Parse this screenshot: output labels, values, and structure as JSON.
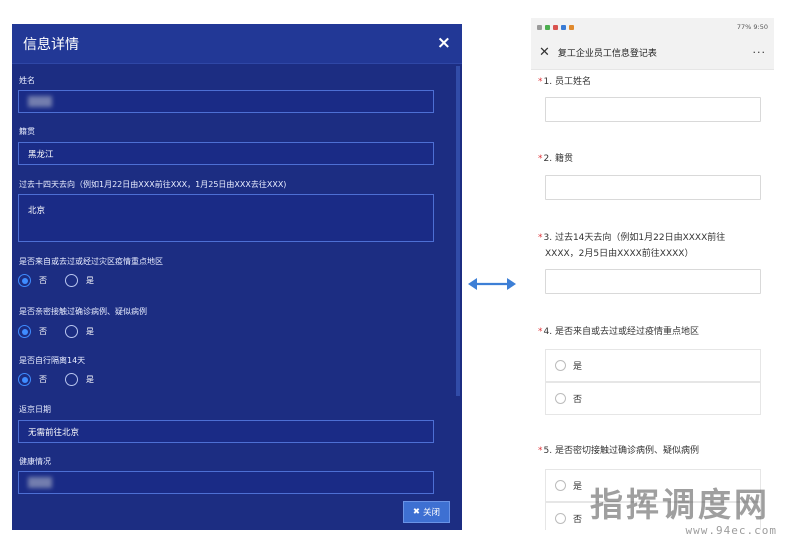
{
  "dialog": {
    "title": "信息详情",
    "close_icon": "×",
    "fields": {
      "name_label": "姓名",
      "native_label": "籍贯",
      "native_value": "黑龙江",
      "route_label": "过去十四天去向（例如1月22日由XXX前往XXX，1月25日由XXX去往XXX)",
      "route_value": "北京",
      "epidemic_label": "是否来自或去过或经过灾区疫情重点地区",
      "contact_label": "是否亲密接触过确诊病例、疑似病例",
      "isolated_label": "是否自行隔离14天",
      "return_label": "返京日期",
      "return_value": "无需前往北京",
      "health_label": "健康情况"
    },
    "radio_no": "否",
    "radio_yes": "是",
    "close_button_icon": "✖",
    "close_button": "关闭"
  },
  "phone": {
    "status_right": "77% 9:50",
    "title": "复工企业员工信息登记表",
    "close_icon": "✕",
    "more_icon": "···",
    "questions": {
      "q1": "1. 员工姓名",
      "q2": "2. 籍贯",
      "q3_line1": "3. 过去14天去向（例如1月22日由XXXX前往",
      "q3_line2": "XXXX，2月5日由XXXX前往XXXX）",
      "q4": "4. 是否来自或去过或经过疫情重点地区",
      "q5": "5. 是否密切接触过确诊病例、疑似病例"
    },
    "required_mark": "*",
    "opt_yes": "是",
    "opt_no": "否"
  },
  "watermark": {
    "main": "指挥调度网",
    "url": "www.94ec.com"
  },
  "colors": {
    "dialog_bg": "#1c2d82",
    "dialog_field_border": "#4d6fd4",
    "radio_accent": "#3f8cff",
    "required": "#e0353a",
    "arrow": "#3d7fd6"
  },
  "icons": [
    "close-icon",
    "double-arrow-icon",
    "more-icon"
  ]
}
